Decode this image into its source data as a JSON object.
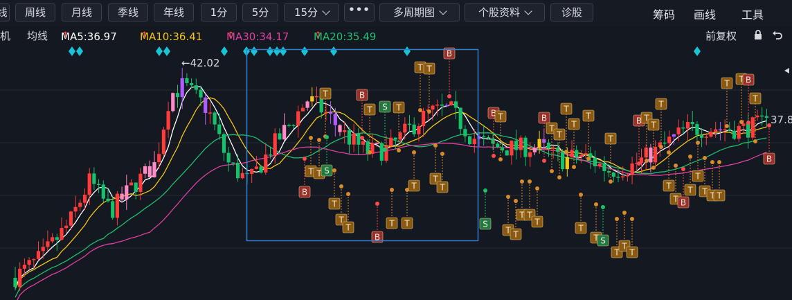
{
  "toolbar": {
    "left_cut": "线",
    "buttons": [
      "周线",
      "月线",
      "季线",
      "年线",
      "1分",
      "5分"
    ],
    "period_select": "15分",
    "more": "•••",
    "multi_period": "多周期图",
    "stock_info": "个股资料",
    "diagnose": "诊股",
    "right_links": [
      "筹码",
      "画线"
    ],
    "tools": "工具"
  },
  "ma_bar": {
    "left_cut": "机",
    "avg_label": "均线",
    "ma5": "MA5:36.97",
    "ma10": "MA10:36.41",
    "ma30": "MA30:34.17",
    "ma20": "MA20:35.49",
    "adjust": "前复权"
  },
  "chart_data": {
    "type": "candlestick",
    "annotations": {
      "high_label": "←42.02",
      "right_price": "37.8"
    },
    "colors": {
      "up": "#ff3b3b",
      "down": "#15c26b",
      "ma5": "#ffffff",
      "ma10": "#f5c518",
      "ma20": "#1fbf6f",
      "ma30": "#e040a0",
      "selection": "#2f7fd8",
      "marker": "#18c3d6"
    }
  }
}
